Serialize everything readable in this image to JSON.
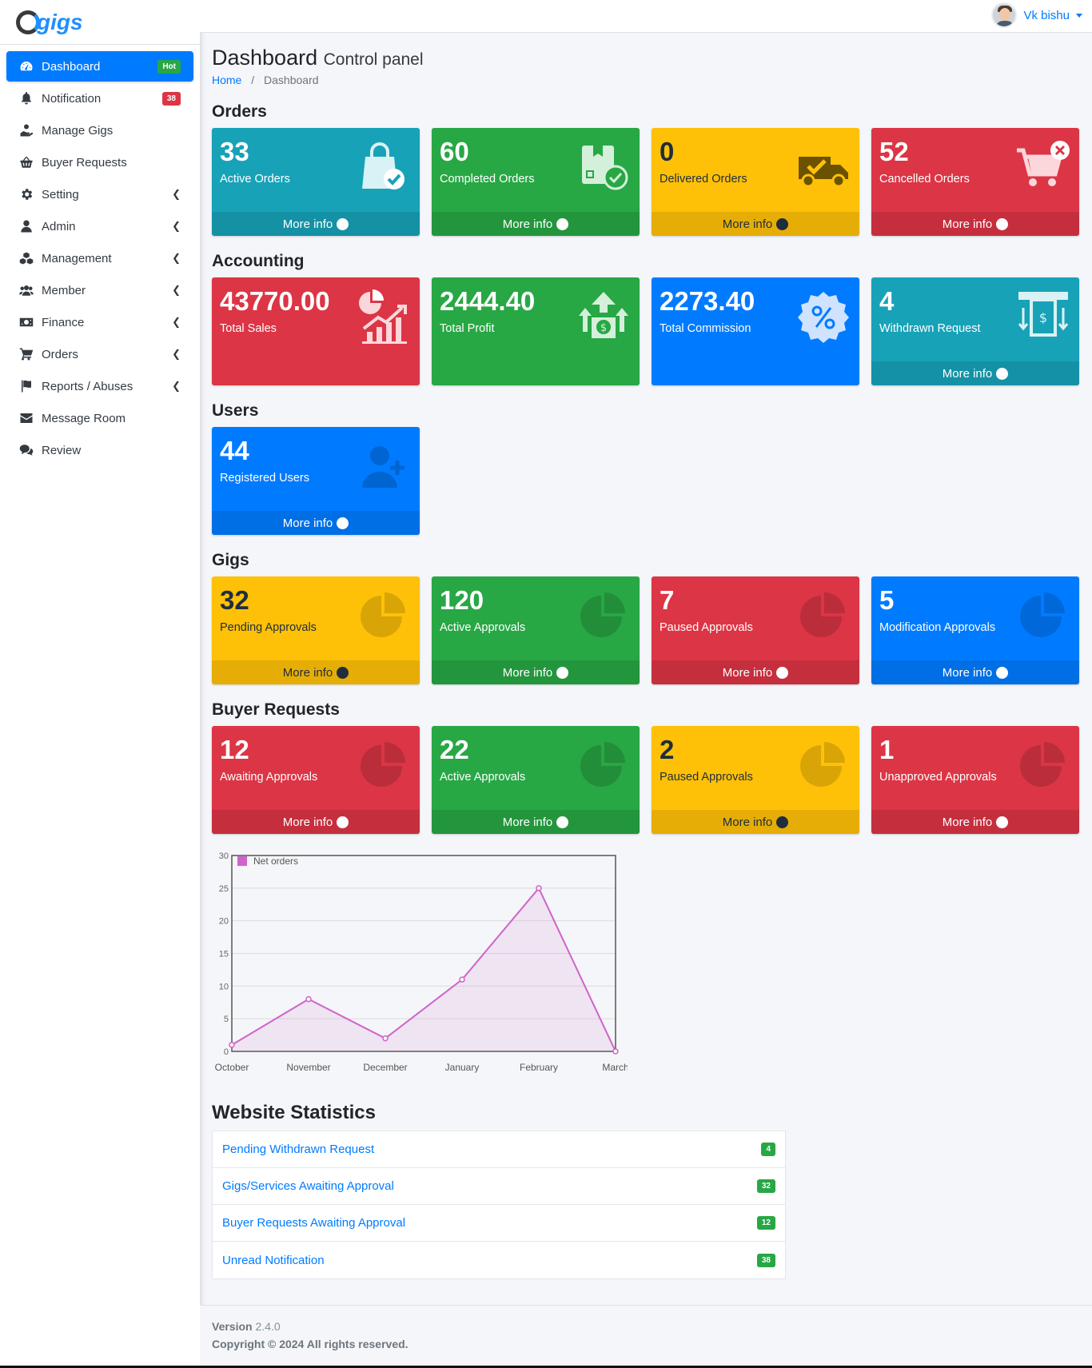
{
  "brand": {
    "name": "gigs"
  },
  "user": {
    "name": "Vk bishu"
  },
  "sidebar": {
    "items": [
      {
        "label": "Dashboard",
        "icon": "dashboard-icon",
        "badge": "Hot",
        "active": true
      },
      {
        "label": "Notification",
        "icon": "bell-icon",
        "badge": "38"
      },
      {
        "label": "Manage Gigs",
        "icon": "hand-user-icon"
      },
      {
        "label": "Buyer Requests",
        "icon": "basket-icon"
      },
      {
        "label": "Setting",
        "icon": "gear-icon",
        "chevron": true
      },
      {
        "label": "Admin",
        "icon": "user-icon",
        "chevron": true
      },
      {
        "label": "Management",
        "icon": "cubes-icon",
        "chevron": true
      },
      {
        "label": "Member",
        "icon": "users-icon",
        "chevron": true
      },
      {
        "label": "Finance",
        "icon": "money-icon",
        "chevron": true
      },
      {
        "label": "Orders",
        "icon": "cart-icon",
        "chevron": true
      },
      {
        "label": "Reports / Abuses",
        "icon": "flag-icon",
        "chevron": true
      },
      {
        "label": "Message Room",
        "icon": "envelope-icon"
      },
      {
        "label": "Review",
        "icon": "comments-icon"
      }
    ]
  },
  "header": {
    "title": "Dashboard",
    "subtitle": "Control panel"
  },
  "breadcrumb": {
    "home": "Home",
    "separator": "/",
    "current": "Dashboard"
  },
  "more_info": "More info",
  "sections": {
    "orders": {
      "title": "Orders",
      "boxes": [
        {
          "value": "33",
          "label": "Active Orders",
          "icon": "shopping-bag-check-icon",
          "color": "#17a2b8"
        },
        {
          "value": "60",
          "label": "Completed Orders",
          "icon": "package-check-icon",
          "color": "#28a745"
        },
        {
          "value": "0",
          "label": "Delivered Orders",
          "icon": "delivery-truck-icon",
          "color": "#ffc107"
        },
        {
          "value": "52",
          "label": "Cancelled Orders",
          "icon": "cart-cancel-icon",
          "color": "#dc3545"
        }
      ]
    },
    "accounting": {
      "title": "Accounting",
      "boxes": [
        {
          "value": "43770.00",
          "label": "Total Sales",
          "icon": "sales-chart-icon",
          "color": "#dc3545"
        },
        {
          "value": "2444.40",
          "label": "Total Profit",
          "icon": "profit-dollar-icon",
          "color": "#28a745"
        },
        {
          "value": "2273.40",
          "label": "Total Commission",
          "icon": "percent-badge-icon",
          "color": "#007bff"
        },
        {
          "value": "4",
          "label": "Withdrawn Request",
          "icon": "withdraw-atm-icon",
          "color": "#17a2b8"
        }
      ]
    },
    "users": {
      "title": "Users",
      "boxes": [
        {
          "value": "44",
          "label": "Registered Users",
          "icon": "user-plus-icon",
          "color": "#007bff"
        }
      ]
    },
    "gigs": {
      "title": "Gigs",
      "boxes": [
        {
          "value": "32",
          "label": "Pending Approvals",
          "icon": "pie-chart-icon",
          "color": "#ffc107"
        },
        {
          "value": "120",
          "label": "Active Approvals",
          "icon": "pie-chart-icon",
          "color": "#28a745"
        },
        {
          "value": "7",
          "label": "Paused Approvals",
          "icon": "pie-chart-icon",
          "color": "#dc3545"
        },
        {
          "value": "5",
          "label": "Modification Approvals",
          "icon": "pie-chart-icon",
          "color": "#007bff"
        }
      ]
    },
    "buyer_requests": {
      "title": "Buyer Requests",
      "boxes": [
        {
          "value": "12",
          "label": "Awaiting Approvals",
          "icon": "pie-chart-icon",
          "color": "#dc3545"
        },
        {
          "value": "22",
          "label": "Active Approvals",
          "icon": "pie-chart-icon",
          "color": "#28a745"
        },
        {
          "value": "2",
          "label": "Paused Approvals",
          "icon": "pie-chart-icon",
          "color": "#ffc107"
        },
        {
          "value": "1",
          "label": "Unapproved Approvals",
          "icon": "pie-chart-icon",
          "color": "#dc3545"
        }
      ]
    }
  },
  "chart_data": {
    "type": "area",
    "categories": [
      "October",
      "November",
      "December",
      "January",
      "February",
      "March"
    ],
    "series": [
      {
        "name": "Net orders",
        "values": [
          1,
          8,
          2,
          11,
          25,
          0
        ],
        "color": "#d063c9"
      }
    ],
    "ylim": [
      0,
      30
    ],
    "yticks": [
      0,
      5,
      10,
      15,
      20,
      25,
      30
    ],
    "grid": true,
    "legend": "top-left"
  },
  "statistics": {
    "title": "Website Statistics",
    "items": [
      {
        "label": "Pending Withdrawn Request",
        "count": "4"
      },
      {
        "label": "Gigs/Services Awaiting Approval",
        "count": "32"
      },
      {
        "label": "Buyer Requests Awaiting Approval",
        "count": "12"
      },
      {
        "label": "Unread Notification",
        "count": "38"
      }
    ]
  },
  "footer": {
    "version_label": "Version",
    "version": "2.4.0",
    "copyright": "Copyright © 2024 All rights reserved."
  }
}
